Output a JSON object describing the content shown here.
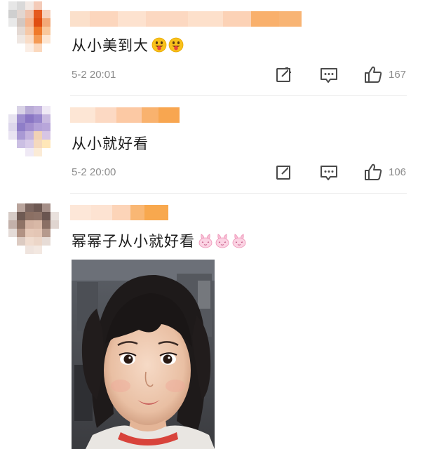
{
  "comments": [
    {
      "text": "从小美到大",
      "emoji": [
        "grinning-tongue-emoji",
        "grinning-tongue-emoji"
      ],
      "timestamp": "5-2 20:01",
      "likes": "167"
    },
    {
      "text": "从小就好看",
      "emoji": [],
      "timestamp": "5-2 20:00",
      "likes": "106"
    },
    {
      "text": "幂幂子从小就好看",
      "emoji": [
        "pink-bunny-emoji",
        "pink-bunny-emoji",
        "pink-bunny-emoji"
      ],
      "timestamp": "",
      "likes": ""
    }
  ],
  "icons": {
    "share": "share-icon",
    "comment": "comment-icon",
    "like": "thumbs-up-icon"
  },
  "colors": {
    "username_blur": "#f6a35a",
    "text": "#1c1c1c",
    "meta": "#8c8c8c",
    "divider": "#ececec"
  }
}
